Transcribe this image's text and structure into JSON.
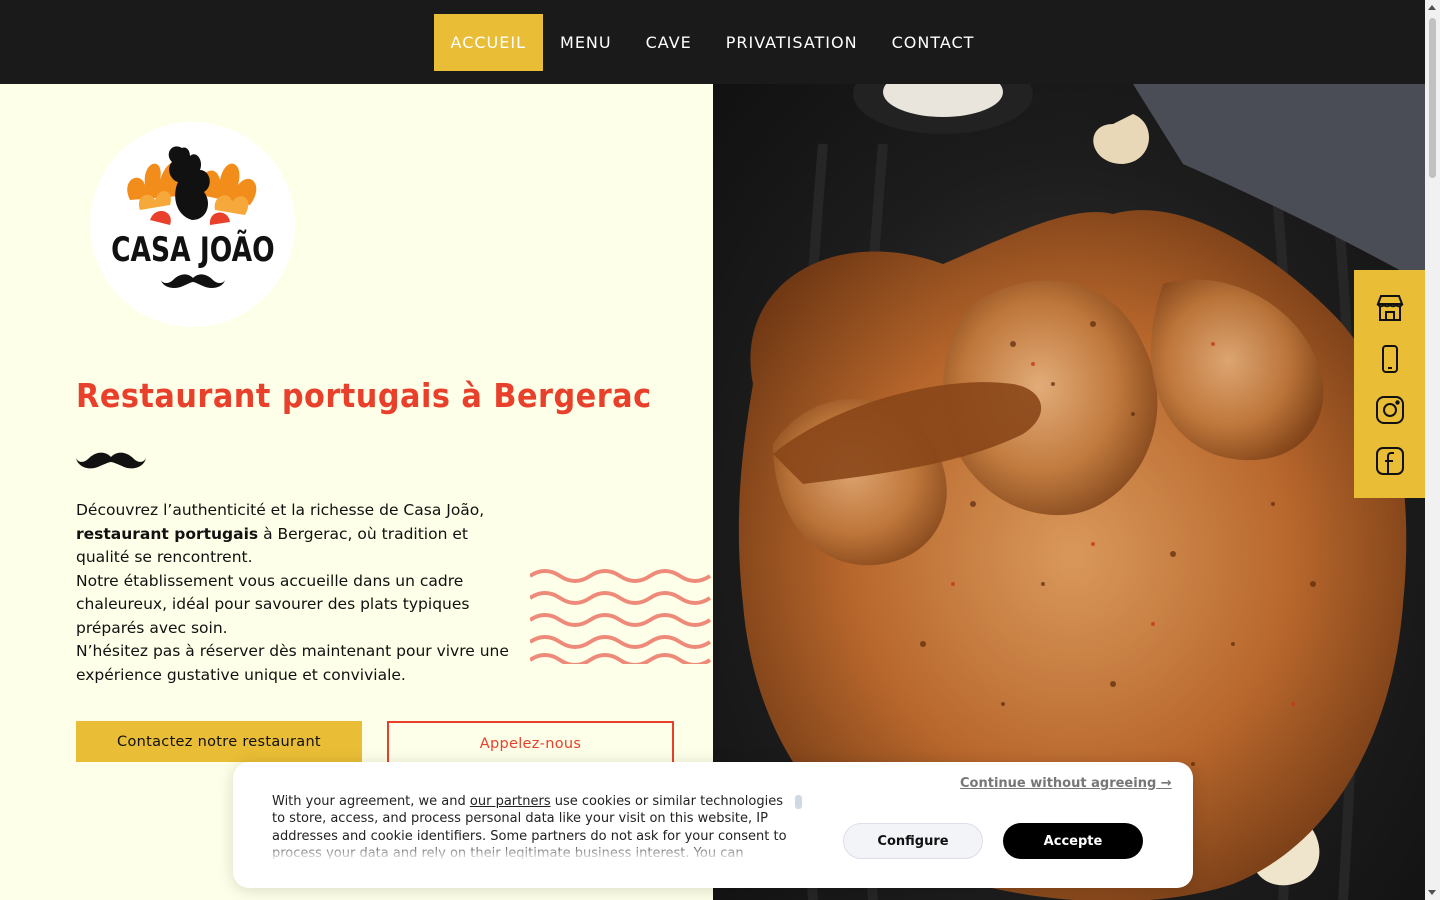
{
  "nav": {
    "items": [
      {
        "label": "ACCUEIL",
        "active": true
      },
      {
        "label": "MENU"
      },
      {
        "label": "CAVE"
      },
      {
        "label": "PRIVATISATION"
      },
      {
        "label": "CONTACT"
      }
    ]
  },
  "brand": {
    "logo_text": "CASA JOÃO"
  },
  "hero": {
    "title": "Restaurant portugais à Bergerac",
    "paragraph1_pre": "Découvrez l’authenticité et la richesse de Casa João, ",
    "paragraph1_bold": "restaurant portugais",
    "paragraph1_post": " à Bergerac, où tradition et qualité se rencontrent.",
    "paragraph2": "Notre établissement vous accueille dans un cadre chaleureux, idéal pour savourer des plats typiques préparés avec soin.",
    "paragraph3": "N’hésitez pas à réserver dès maintenant pour vivre une expérience gustative unique et conviviale.",
    "contact_button": "Contactez notre restaurant",
    "call_button": "Appelez-nous"
  },
  "social": {
    "icons": [
      "restaurant-store-icon",
      "phone-icon",
      "instagram-icon",
      "facebook-icon"
    ]
  },
  "cookie": {
    "text_pre": "With your agreement, we and ",
    "partners_link": "our partners",
    "text_post": " use cookies or similar technologies to store, access, and process personal data like your visit on this website, IP addresses and cookie identifiers. Some partners do not ask for your consent to process your data and rely on their legitimate business interest. You can",
    "continue_link": "Continue without agreeing →",
    "configure_button": "Configure",
    "accept_button": "Accepte"
  },
  "colors": {
    "accent_yellow": "#e9bd35",
    "title_red": "#e8402b",
    "nav_bg": "#1a1a1a",
    "page_bg": "#fdffe8"
  }
}
